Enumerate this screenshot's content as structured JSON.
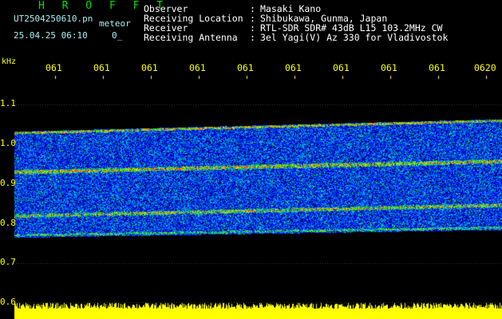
{
  "app": {
    "title": "H R O F F T"
  },
  "file": {
    "name": "UT2504250610.pn",
    "type_label": "meteor",
    "date_time": "25.04.25 06:10",
    "count": "0_"
  },
  "info": {
    "rows": [
      {
        "key": "Observer",
        "value": "Masaki Kano"
      },
      {
        "key": "Receiving Location",
        "value": "Shibukawa, Gunma, Japan"
      },
      {
        "key": "Receiver",
        "value": "RTL-SDR SDR# 43dB L15 103.2MHz CW"
      },
      {
        "key": "Receiving Antenna",
        "value": "3el Yagi(V) Az 330 for Vladivostok"
      }
    ]
  },
  "axis": {
    "y_unit": "kHz",
    "y_ticks": [
      "1.1",
      "1.0",
      "0.9",
      "0.8",
      "0.7",
      "0.6"
    ],
    "x_ticks": [
      "061",
      "061",
      "061",
      "061",
      "061",
      "061",
      "061",
      "061",
      "061",
      "0620"
    ]
  },
  "colors": {
    "header_title": "#00e000",
    "header_text": "#a8f0f0",
    "ticks": "#ffff00",
    "signal_bar": "#ffff00"
  }
}
